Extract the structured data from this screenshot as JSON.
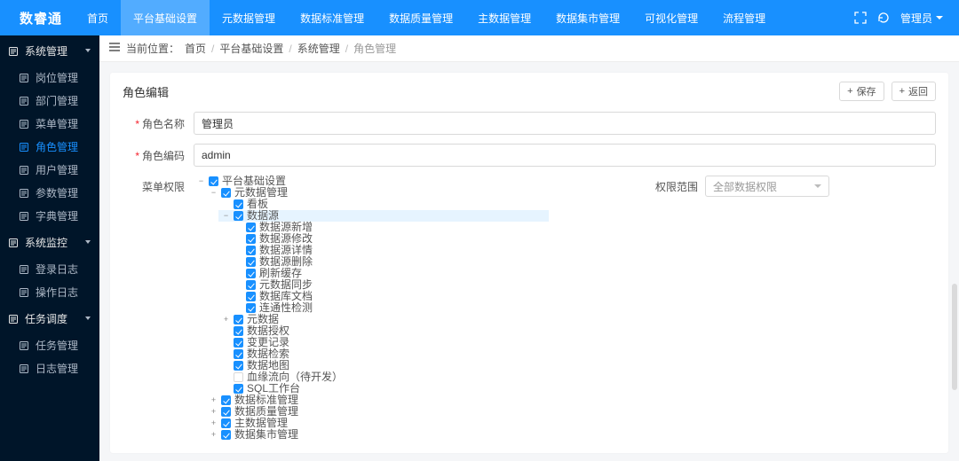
{
  "brand": "数睿通",
  "topnav": [
    {
      "label": "首页"
    },
    {
      "label": "平台基础设置",
      "active": true
    },
    {
      "label": "元数据管理"
    },
    {
      "label": "数据标准管理"
    },
    {
      "label": "数据质量管理"
    },
    {
      "label": "主数据管理"
    },
    {
      "label": "数据集市管理"
    },
    {
      "label": "可视化管理"
    },
    {
      "label": "流程管理"
    }
  ],
  "user_label": "管理员",
  "sidebar": {
    "groups": [
      {
        "title": "系统管理",
        "expanded": true,
        "items": [
          {
            "label": "岗位管理"
          },
          {
            "label": "部门管理"
          },
          {
            "label": "菜单管理"
          },
          {
            "label": "角色管理",
            "active": true
          },
          {
            "label": "用户管理"
          },
          {
            "label": "参数管理"
          },
          {
            "label": "字典管理"
          }
        ]
      },
      {
        "title": "系统监控",
        "expanded": true,
        "items": [
          {
            "label": "登录日志"
          },
          {
            "label": "操作日志"
          }
        ]
      },
      {
        "title": "任务调度",
        "expanded": true,
        "items": [
          {
            "label": "任务管理"
          },
          {
            "label": "日志管理"
          }
        ]
      }
    ]
  },
  "breadcrumb": {
    "prefix": "当前位置：",
    "items": [
      "首页",
      "平台基础设置",
      "系统管理",
      "角色管理"
    ]
  },
  "panel": {
    "title": "角色编辑",
    "save_label": "保存",
    "back_label": "返回"
  },
  "form": {
    "name_label": "角色名称",
    "name_value": "管理员",
    "code_label": "角色编码",
    "code_value": "admin",
    "menu_perm_label": "菜单权限",
    "scope_label": "权限范围",
    "scope_value": "全部数据权限"
  },
  "tree": [
    {
      "label": "平台基础设置",
      "checked": true,
      "expander": "-",
      "children": [
        {
          "label": "元数据管理",
          "checked": true,
          "expander": "-",
          "children": [
            {
              "label": "看板",
              "checked": true
            },
            {
              "label": "数据源",
              "checked": true,
              "expander": "-",
              "selected": true,
              "children": [
                {
                  "label": "数据源新增",
                  "checked": true
                },
                {
                  "label": "数据源修改",
                  "checked": true
                },
                {
                  "label": "数据源详情",
                  "checked": true
                },
                {
                  "label": "数据源删除",
                  "checked": true
                },
                {
                  "label": "刷新缓存",
                  "checked": true
                },
                {
                  "label": "元数据同步",
                  "checked": true
                },
                {
                  "label": "数据库文档",
                  "checked": true
                },
                {
                  "label": "连通性检测",
                  "checked": true
                }
              ]
            },
            {
              "label": "元数据",
              "checked": true,
              "expander": "+"
            },
            {
              "label": "数据授权",
              "checked": true
            },
            {
              "label": "变更记录",
              "checked": true
            },
            {
              "label": "数据检索",
              "checked": true
            },
            {
              "label": "数据地图",
              "checked": true
            },
            {
              "label": "血缘流向（待开发）",
              "checked": false
            },
            {
              "label": "SQL工作台",
              "checked": true
            }
          ]
        },
        {
          "label": "数据标准管理",
          "checked": true,
          "expander": "+"
        },
        {
          "label": "数据质量管理",
          "checked": true,
          "expander": "+"
        },
        {
          "label": "主数据管理",
          "checked": true,
          "expander": "+"
        },
        {
          "label": "数据集市管理",
          "checked": true,
          "expander": "+"
        }
      ]
    }
  ]
}
